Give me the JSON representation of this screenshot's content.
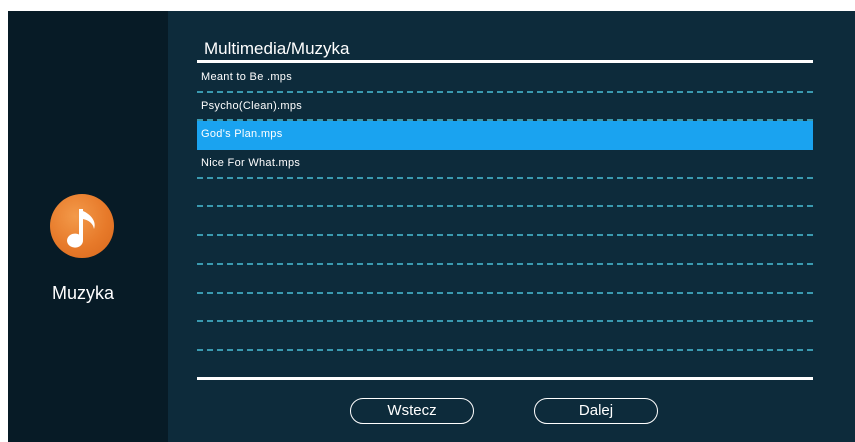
{
  "sidebar": {
    "app_icon": "music-note-icon",
    "app_label": "Muzyka"
  },
  "header": {
    "title": "Multimedia/Muzyka"
  },
  "files": [
    {
      "name": "Meant to Be .mps",
      "selected": false
    },
    {
      "name": "Psycho(Clean).mps",
      "selected": false
    },
    {
      "name": "God's Plan.mps",
      "selected": true
    },
    {
      "name": "Nice For What.mps",
      "selected": false
    },
    {
      "name": "",
      "selected": false
    },
    {
      "name": "",
      "selected": false
    },
    {
      "name": "",
      "selected": false
    },
    {
      "name": "",
      "selected": false
    },
    {
      "name": "",
      "selected": false
    },
    {
      "name": "",
      "selected": false
    },
    {
      "name": "",
      "selected": false
    }
  ],
  "buttons": {
    "back_label": "Wstecz",
    "next_label": "Dalej"
  },
  "colors": {
    "background": "#0d2b3b",
    "sidebar_background": "#071b26",
    "selection": "#1aa3f0",
    "divider": "#3a9ab0",
    "icon_orange": "#e77a2a"
  }
}
